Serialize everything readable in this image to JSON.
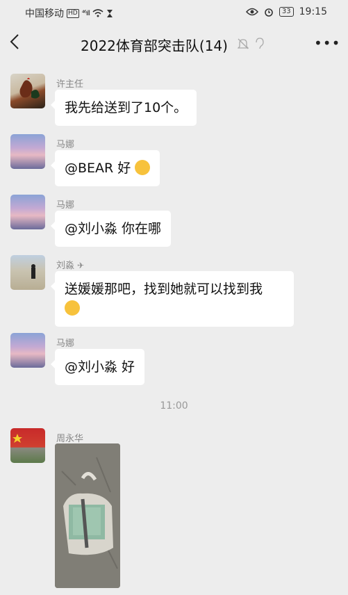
{
  "status_bar": {
    "carrier": "中国移动",
    "hd": "HD",
    "signal": "⁴⁶ıll",
    "battery": "33",
    "time": "19:15"
  },
  "header": {
    "title": "2022体育部突击队(14)"
  },
  "messages": [
    {
      "sender": "许主任",
      "text": "我先给送到了10个。"
    },
    {
      "sender": "马娜",
      "text": "@BEAR  好"
    },
    {
      "sender": "马娜",
      "text": "@刘小淼  你在哪"
    },
    {
      "sender": "刘淼",
      "text_line1": "送媛媛那吧，找到她就可以找到我",
      "text_line2": ""
    },
    {
      "sender": "马娜",
      "text": "@刘小淼  好"
    },
    {
      "sender": "周永华"
    }
  ],
  "timestamp": "11:00",
  "colors": {
    "background": "#ededed",
    "bubble": "#ffffff",
    "sender_name": "#888888"
  }
}
